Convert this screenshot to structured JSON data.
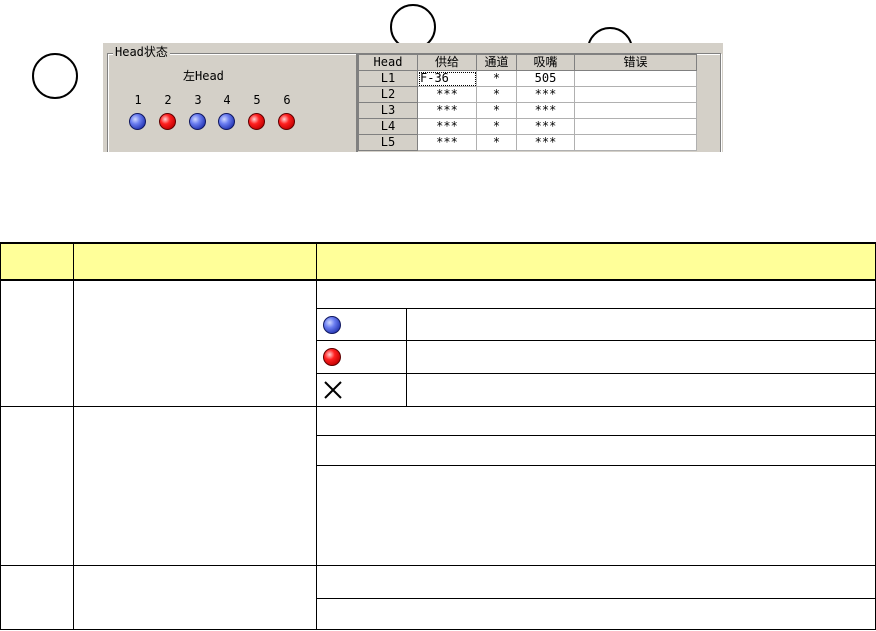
{
  "callouts": [
    "",
    "",
    ""
  ],
  "head_panel": {
    "group_title": "Head状态",
    "head_name": "左Head",
    "nozzles": [
      {
        "num": "1",
        "state": "blue"
      },
      {
        "num": "2",
        "state": "red"
      },
      {
        "num": "3",
        "state": "blue"
      },
      {
        "num": "4",
        "state": "blue"
      },
      {
        "num": "5",
        "state": "red"
      },
      {
        "num": "6",
        "state": "red"
      }
    ]
  },
  "grid": {
    "columns": [
      "Head",
      "供给",
      "通道",
      "吸嘴",
      "错误"
    ],
    "rows": [
      {
        "head": "L1",
        "supply": "F-36",
        "channel": "*",
        "nozzle": "505",
        "error": ""
      },
      {
        "head": "L2",
        "supply": "***",
        "channel": "*",
        "nozzle": "***",
        "error": ""
      },
      {
        "head": "L3",
        "supply": "***",
        "channel": "*",
        "nozzle": "***",
        "error": ""
      },
      {
        "head": "L4",
        "supply": "***",
        "channel": "*",
        "nozzle": "***",
        "error": ""
      },
      {
        "head": "L5",
        "supply": "***",
        "channel": "*",
        "nozzle": "***",
        "error": ""
      }
    ]
  },
  "legend": {
    "header": [
      "",
      "",
      ""
    ],
    "icons": [
      "blue-circle-icon",
      "red-circle-icon",
      "cross-icon"
    ],
    "colors": {
      "header_bg": "#ffff99",
      "blue": "#2233b0",
      "red": "#c00000"
    }
  }
}
